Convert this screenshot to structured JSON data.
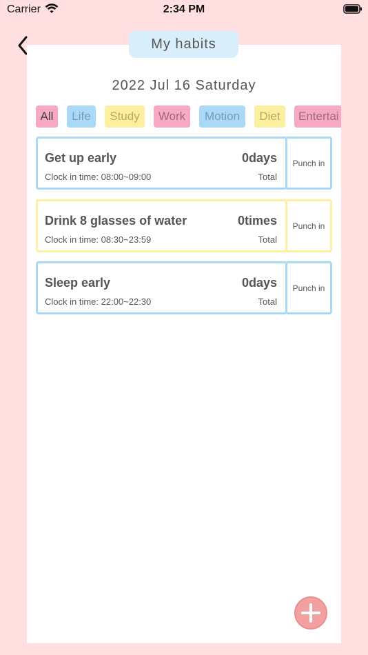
{
  "status_bar": {
    "carrier": "Carrier",
    "time": "2:34 PM"
  },
  "header": {
    "title": "My habits",
    "date": "2022 Jul 16 Saturday"
  },
  "tabs": [
    {
      "label": "All",
      "selected": true
    },
    {
      "label": "Life"
    },
    {
      "label": "Study"
    },
    {
      "label": "Work"
    },
    {
      "label": "Motion"
    },
    {
      "label": "Diet"
    },
    {
      "label": "Entertai"
    }
  ],
  "habits": [
    {
      "name": "Get up early",
      "clock_in": "Clock in time: 08:00~09:00",
      "count": "0days",
      "total": "Total",
      "punch": "Punch in"
    },
    {
      "name": "Drink 8 glasses of water",
      "clock_in": "Clock in time: 08:30~23:59",
      "count": "0times",
      "total": "Total",
      "punch": "Punch in"
    },
    {
      "name": "Sleep early",
      "clock_in": "Clock in time: 22:00~22:30",
      "count": "0days",
      "total": "Total",
      "punch": "Punch in"
    }
  ],
  "colors": {
    "background": "#ffdfe0",
    "pink": "#f7a9c3",
    "blue": "#aad8f7",
    "yellow": "#fcf0a0",
    "add_button": "#f3a0a0"
  },
  "icons": {
    "back": "chevron-left-icon",
    "add": "plus-icon",
    "wifi": "wifi-icon",
    "battery": "battery-icon"
  }
}
